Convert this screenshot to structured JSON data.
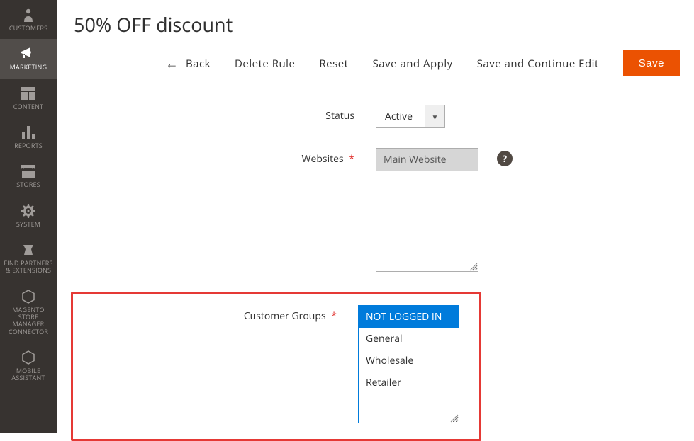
{
  "sidebar": {
    "items": [
      {
        "label": "CUSTOMERS"
      },
      {
        "label": "MARKETING"
      },
      {
        "label": "CONTENT"
      },
      {
        "label": "REPORTS"
      },
      {
        "label": "STORES"
      },
      {
        "label": "SYSTEM"
      },
      {
        "label": "FIND PARTNERS & EXTENSIONS"
      },
      {
        "label": "MAGENTO STORE MANAGER CONNECTOR"
      },
      {
        "label": "MOBILE ASSISTANT"
      }
    ]
  },
  "page": {
    "title": "50% OFF discount"
  },
  "toolbar": {
    "back": "Back",
    "delete": "Delete Rule",
    "reset": "Reset",
    "save_apply": "Save and Apply",
    "save_continue": "Save and Continue Edit",
    "save": "Save"
  },
  "fields": {
    "status": {
      "label": "Status",
      "value": "Active"
    },
    "websites": {
      "label": "Websites",
      "options": [
        "Main Website"
      ]
    },
    "customer_groups": {
      "label": "Customer Groups",
      "options": [
        "NOT LOGGED IN",
        "General",
        "Wholesale",
        "Retailer"
      ]
    }
  }
}
